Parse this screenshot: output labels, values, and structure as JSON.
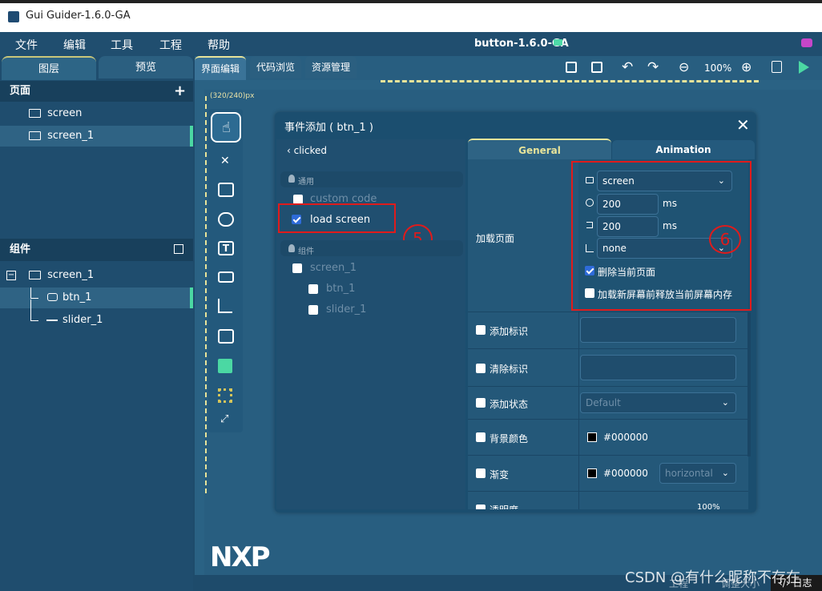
{
  "app": {
    "title": "Gui Guider-1.6.0-GA",
    "project": "button-1.6.0-GA"
  },
  "menu": [
    "文件",
    "编辑",
    "工具",
    "工程",
    "帮助"
  ],
  "left_tabs": {
    "layers": "图层",
    "preview": "预览"
  },
  "pages": {
    "header": "页面",
    "add": "+",
    "items": [
      "screen",
      "screen_1"
    ]
  },
  "components": {
    "header": "组件",
    "items": [
      "screen_1",
      "btn_1",
      "slider_1"
    ],
    "collapse": "−"
  },
  "editor_tabs": [
    "界面编辑",
    "代码浏览",
    "资源管理"
  ],
  "zoom": "100%",
  "canvas": {
    "resolution": "(320/240)px"
  },
  "modal": {
    "title": "事件添加 ( btn_1 )",
    "event": "clicked",
    "groups": {
      "common": "通用",
      "components": "组件"
    },
    "common_items": [
      {
        "label": "custom code",
        "checked": false
      },
      {
        "label": "load screen",
        "checked": true
      }
    ],
    "component_items": [
      {
        "label": "screen_1"
      },
      {
        "label": "btn_1"
      },
      {
        "label": "slider_1"
      }
    ],
    "tabs": {
      "general": "General",
      "animation": "Animation"
    },
    "load_page": {
      "label": "加载页面",
      "screen": "screen",
      "delay": "200",
      "delay_unit": "ms",
      "duration": "200",
      "duration_unit": "ms",
      "anim": "none",
      "delete_current": {
        "label": "删除当前页面",
        "checked": true
      },
      "release_memory": {
        "label": "加载新屏幕前释放当前屏幕内存",
        "checked": false
      }
    },
    "props": [
      {
        "label": "添加标识",
        "value": ""
      },
      {
        "label": "清除标识",
        "value": ""
      },
      {
        "label": "添加状态",
        "value": "Default"
      },
      {
        "label": "背景颜色",
        "value": "#000000"
      },
      {
        "label": "渐变",
        "value": "#000000",
        "dir": "horizontal"
      },
      {
        "label": "透明度",
        "value": "100%"
      }
    ],
    "annotations": {
      "a5": "5",
      "a6": "6"
    }
  },
  "bottom": {
    "logo": "NXP",
    "status1": "工程",
    "status2": "调整大小",
    "log": "日志",
    "watermark": "CSDN @有什么昵称不存在"
  },
  "colors": {
    "accent": "#4bd8a3",
    "highlight": "#e8e49a",
    "annotation": "#e01b1b",
    "checkbox": "#2e6bd9"
  }
}
